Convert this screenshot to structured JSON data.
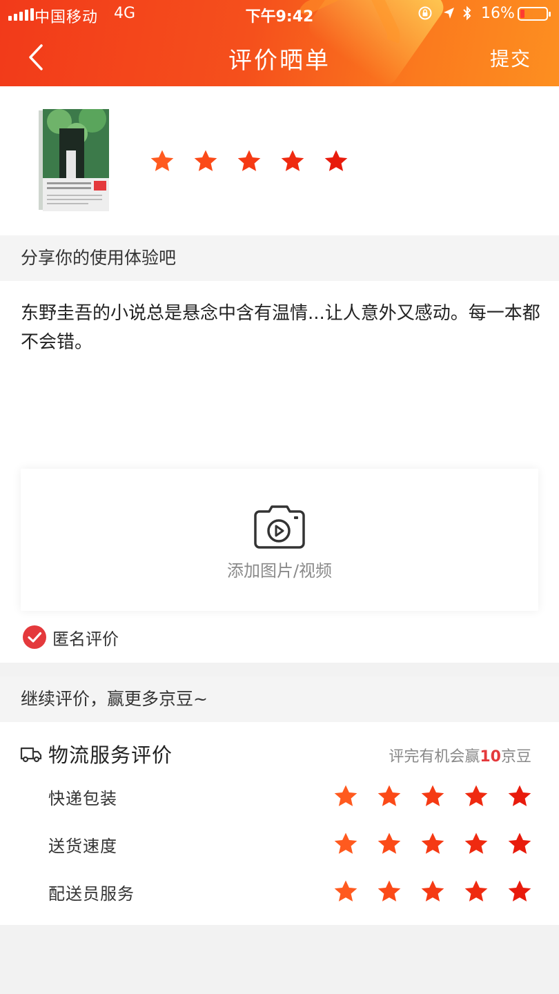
{
  "status_bar": {
    "carrier": "中国移动",
    "network": "4G",
    "time": "下午9:42",
    "battery": "16%"
  },
  "nav": {
    "title": "评价晒单",
    "submit_label": "提交"
  },
  "product": {
    "book_title": "秘密",
    "book_author": "东野圭吾",
    "rating": 5,
    "star_colors": [
      "#ff5a1f",
      "#fb4a18",
      "#f53a14",
      "#ef2a10",
      "#e81b0c"
    ]
  },
  "share_section": {
    "title": "分享你的使用体验吧"
  },
  "review": {
    "text": "东野圭吾的小说总是悬念中含有温情...让人意外又感动。每一本都不会错。"
  },
  "upload": {
    "label": "添加图片/视频",
    "icon": "camera-video-icon"
  },
  "anonymous": {
    "label": "匿名评价",
    "checked": true
  },
  "more_section": {
    "title": "继续评价，赢更多京豆~"
  },
  "logistics": {
    "title": "物流服务评价",
    "hint_prefix": "评完有机会赢",
    "hint_number": "10",
    "hint_suffix": "京豆",
    "items": [
      {
        "label": "快递包装",
        "rating": 5
      },
      {
        "label": "送货速度",
        "rating": 5
      },
      {
        "label": "配送员服务",
        "rating": 5
      }
    ]
  }
}
